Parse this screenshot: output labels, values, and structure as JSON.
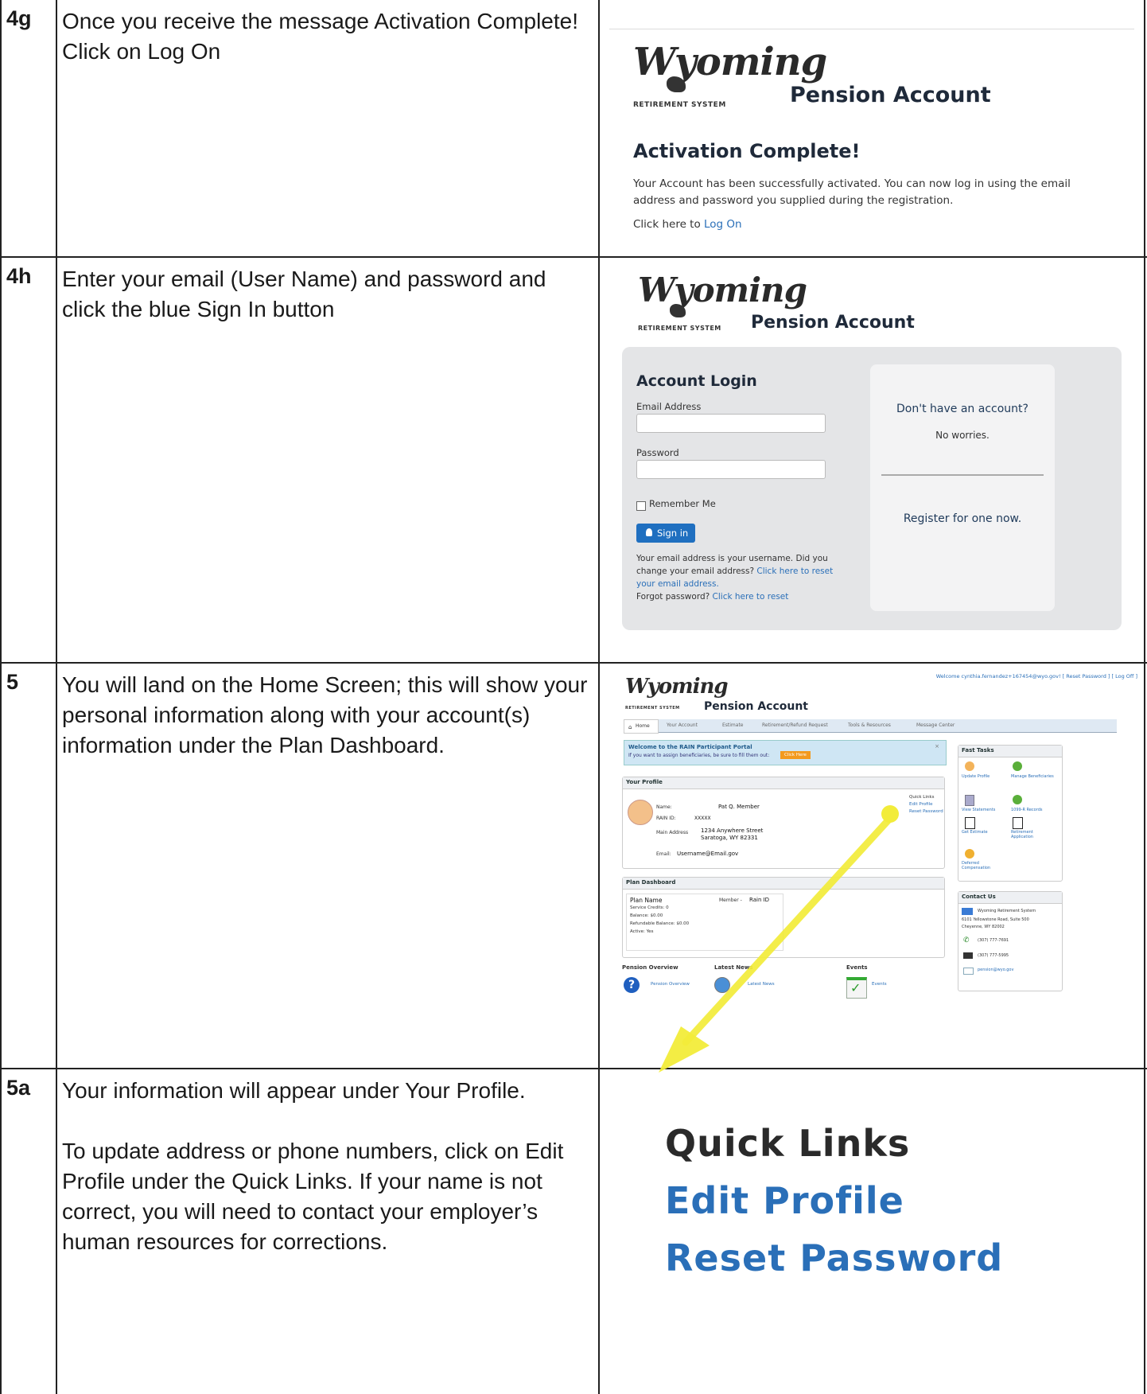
{
  "rows": [
    {
      "step": "4g",
      "text": [
        "Once you receive the message Activation Complete! Click on Log On"
      ]
    },
    {
      "step": "4h",
      "text": [
        "Enter your email (User Name) and password and click the blue Sign In button"
      ]
    },
    {
      "step": "5",
      "text": [
        "You will land on the Home Screen; this will show your personal information along with your account(s) information under the Plan Dashboard."
      ]
    },
    {
      "step": "5a",
      "text": [
        "Your information will appear under Your Profile.",
        "To update address or phone numbers, click on Edit Profile under the Quick Links.  If your name is not correct, you will need to contact your employer’s human resources for corrections."
      ]
    }
  ],
  "logo": {
    "script": "Wyoming",
    "sub": "RETIREMENT SYSTEM",
    "title": "Pension Account"
  },
  "activation": {
    "heading": "Activation Complete!",
    "body": "Your Account has been successfully activated. You can now log in using the email address and password you supplied during the registration.",
    "click_prefix": "Click here to ",
    "log_on": "Log On"
  },
  "login": {
    "heading": "Account Login",
    "email_label": "Email Address",
    "password_label": "Password",
    "remember": "Remember Me",
    "sign_in": "Sign in",
    "note1": "Your email address is your username. Did you change your email address?",
    "reset_email_link": "Click here to reset your email address.",
    "forgot": "Forgot password?",
    "reset_link": "Click here to reset",
    "no_account": "Don't have an account?",
    "no_worries": "No worries.",
    "register": "Register for one now."
  },
  "home": {
    "welcome_bar": "Welcome cynthia.fernandez+167454@wyo.gov! [ Reset Password ] [ Log Off ]",
    "nav": [
      "Home",
      "Your Account",
      "Estimate",
      "Retirement/Refund Request",
      "Tools & Resources",
      "Message Center"
    ],
    "banner_title": "Welcome to the RAIN Participant Portal",
    "banner_text": "If you want to assign beneficiaries, be sure to fill them out:",
    "banner_btn": "Click Here",
    "profile_title": "Your Profile",
    "name_label": "Name:",
    "name_value": "Pat Q. Member",
    "rain_label": "RAIN ID:",
    "rain_value": "XXXXX",
    "address_label": "Main Address",
    "address_line1": "1234 Anywhere Street",
    "address_line2": "Saratoga, WY 82331",
    "email_label": "Email:",
    "email_value": "Username@Email.gov",
    "quick_links": "Quick Links",
    "edit_profile": "Edit Profile",
    "reset_password": "Reset Password",
    "plan_title": "Plan Dashboard",
    "plan_name": "Plan Name",
    "member": "Member -",
    "rain_id": "Rain ID",
    "service_credits": "Service Credits: 0",
    "balance": "Balance: $0.00",
    "refundable": "Refundable Balance: $0.00",
    "active": "Active: Yes",
    "pension_overview": "Pension Overview",
    "latest_news": "Latest News",
    "events": "Events",
    "pension_overview_link": "Pension Overview",
    "latest_news_link": "Latest News",
    "events_link": "Events",
    "fast_tasks": "Fast Tasks",
    "tasks": [
      "Update Profile",
      "Manage Beneficiaries",
      "View Statements",
      "1099-R Records",
      "Get Estimate",
      "Retirement Application",
      "Deferred Compensation"
    ],
    "contact_title": "Contact Us",
    "contact_org": "Wyoming Retirement System",
    "contact_addr1": "6101 Yellowstone Road, Suite 500",
    "contact_addr2": "Cheyenne, WY 82002",
    "phone": "(307) 777-7691",
    "fax": "(307) 777-5995",
    "email": "pension@wyo.gov"
  },
  "zoom": {
    "quick_links": "Quick Links",
    "edit_profile": "Edit Profile",
    "reset_password": "Reset Password"
  },
  "colors": {
    "arrow": "#f2ec3a",
    "link_blue": "#2a6fb8",
    "sign_in_blue": "#1f6fc0",
    "banner_orange": "#f39a1e"
  }
}
